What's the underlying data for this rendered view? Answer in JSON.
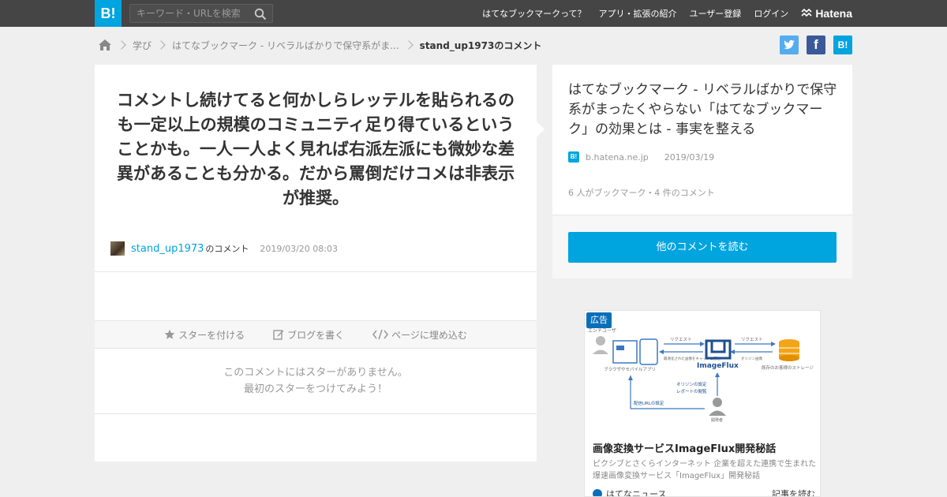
{
  "header": {
    "logo": "B!",
    "search_placeholder": "キーワード・URLを検索",
    "nav": [
      "はてなブックマークって？",
      "アプリ・拡張の紹介",
      "ユーザー登録",
      "ログイン"
    ],
    "brand": "Hatena"
  },
  "breadcrumb": {
    "items": [
      "学び",
      "はてなブックマーク - リベラルばかりで保守系がま...",
      "stand_up1973のコメント"
    ]
  },
  "share": {
    "twitter": "t",
    "facebook": "f",
    "hatena": "B!"
  },
  "comment": {
    "text": "コメントし続けてると何かしらレッテルを貼られるのも一定以上の規模のコミュニティ足り得ているということかも。一人一人よく見れば右派左派にも微妙な差異があることも分かる。だから罵倒だけコメは非表示が推奨。",
    "user": "stand_up1973",
    "suffix": "のコメント",
    "time": "2019/03/20 08:03"
  },
  "actions": {
    "star": "スターを付ける",
    "blog": "ブログを書く",
    "embed": "ページに埋め込む"
  },
  "nostar": {
    "line1": "このコメントにはスターがありません。",
    "line2": "最初のスターをつけてみよう！"
  },
  "entry": {
    "title": "はてなブックマーク - リベラルばかりで保守系がまったくやらない「はてなブックマーク」の効果とは - 事実を整える",
    "favicon": "B!",
    "domain": "b.hatena.ne.jp",
    "date": "2019/03/19",
    "stats": "6 人がブックマーク・4 件のコメント",
    "read_button": "他のコメントを読む"
  },
  "ad": {
    "badge": "広告",
    "diagram": {
      "end_user": "エンドユーザ",
      "request1": "リクエスト",
      "request2": "リクエスト",
      "imageflux": "ImageFlux",
      "origin": "オリジン画像",
      "browser": "ブラウザやモバイルアプリ",
      "storage": "既存のお客様のストレージ",
      "cache": "最適化された画像をキャッシュ配信",
      "settings1": "オリジンの設定",
      "settings2": "レポートの閲覧",
      "delivery": "配信URLの設定",
      "developer": "開発者"
    },
    "title": "画像変換サービスImageFlux開発秘話",
    "desc": "ピクシブとさくらインターネット 企業を超えた連携で生まれた爆速画像変換サービス「ImageFlux」開発秘話",
    "source": "はてなニュース",
    "read_more": "記事を読む"
  },
  "colors": {
    "brand": "#00a4de",
    "twitter": "#55acee",
    "facebook": "#3b5998",
    "topbar": "#454545"
  }
}
